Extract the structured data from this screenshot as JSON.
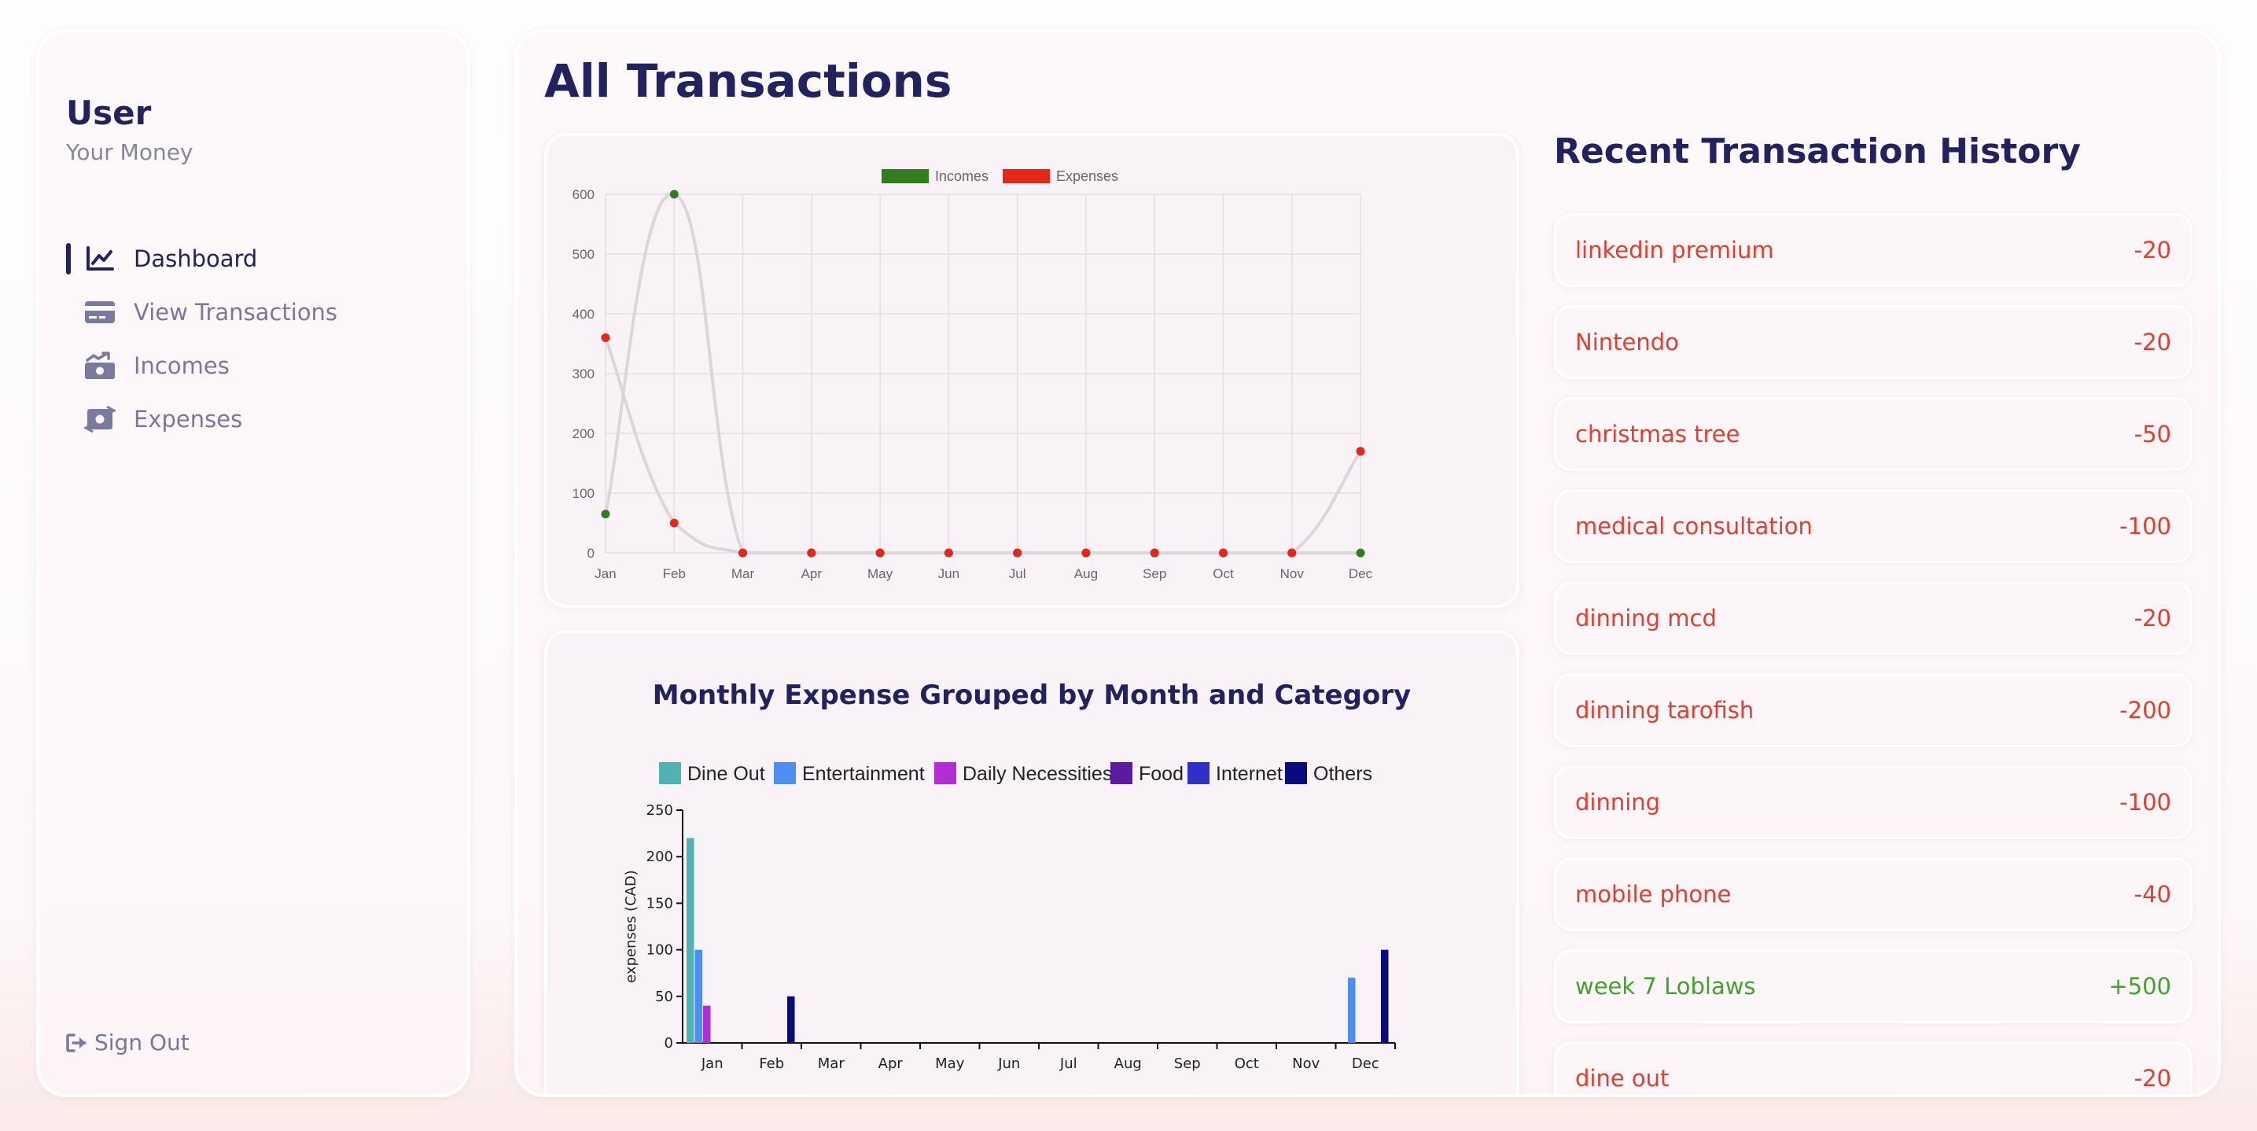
{
  "sidebar": {
    "user_name": "User",
    "user_subtitle": "Your Money",
    "nav": [
      {
        "label": "Dashboard",
        "icon": "chart-line-icon",
        "active": true
      },
      {
        "label": "View Transactions",
        "icon": "credit-card-icon",
        "active": false
      },
      {
        "label": "Incomes",
        "icon": "money-bill-trend-up-icon",
        "active": false
      },
      {
        "label": "Expenses",
        "icon": "money-bill-transfer-icon",
        "active": false
      }
    ],
    "signout_label": "Sign Out"
  },
  "main": {
    "title": "All Transactions",
    "history_title": "Recent Transaction History",
    "history": [
      {
        "name": "linkedin premium",
        "amount": "-20",
        "type": "expense"
      },
      {
        "name": "Nintendo",
        "amount": "-20",
        "type": "expense"
      },
      {
        "name": "christmas tree",
        "amount": "-50",
        "type": "expense"
      },
      {
        "name": "medical consultation",
        "amount": "-100",
        "type": "expense"
      },
      {
        "name": "dinning mcd",
        "amount": "-20",
        "type": "expense"
      },
      {
        "name": "dinning tarofish",
        "amount": "-200",
        "type": "expense"
      },
      {
        "name": "dinning",
        "amount": "-100",
        "type": "expense"
      },
      {
        "name": "mobile phone",
        "amount": "-40",
        "type": "expense"
      },
      {
        "name": "week 7 Loblaws",
        "amount": "+500",
        "type": "income"
      },
      {
        "name": "dine out",
        "amount": "-20",
        "type": "expense"
      }
    ]
  },
  "colors": {
    "income": "#42a22d",
    "expense": "#e03e30",
    "primary": "#222260"
  },
  "chart_data": [
    {
      "type": "line",
      "title": "",
      "x": [
        "Jan",
        "Feb",
        "Mar",
        "Apr",
        "May",
        "Jun",
        "Jul",
        "Aug",
        "Sep",
        "Oct",
        "Nov",
        "Dec"
      ],
      "series": [
        {
          "name": "Incomes",
          "color": "#2f7d1f",
          "values": [
            65,
            600,
            0,
            0,
            0,
            0,
            0,
            0,
            0,
            0,
            0,
            0
          ]
        },
        {
          "name": "Expenses",
          "color": "#e3271a",
          "values": [
            360,
            50,
            0,
            0,
            0,
            0,
            0,
            0,
            0,
            0,
            0,
            170
          ]
        }
      ],
      "ylim": [
        0,
        600
      ],
      "yticks": [
        0,
        100,
        200,
        300,
        400,
        500,
        600
      ],
      "legend": "top",
      "grid": true
    },
    {
      "type": "bar",
      "title": "Monthly Expense Grouped by Month and Category",
      "ylabel": "expenses (CAD)",
      "categories": [
        "Jan",
        "Feb",
        "Mar",
        "Apr",
        "May",
        "Jun",
        "Jul",
        "Aug",
        "Sep",
        "Oct",
        "Nov",
        "Dec"
      ],
      "series": [
        {
          "name": "Dine Out",
          "color": "#4fb3b3",
          "values": [
            220,
            0,
            0,
            0,
            0,
            0,
            0,
            0,
            0,
            0,
            0,
            0
          ]
        },
        {
          "name": "Entertainment",
          "color": "#4d8ff0",
          "values": [
            100,
            0,
            0,
            0,
            0,
            0,
            0,
            0,
            0,
            0,
            0,
            70
          ]
        },
        {
          "name": "Daily Necessities",
          "color": "#b32cd6",
          "values": [
            40,
            0,
            0,
            0,
            0,
            0,
            0,
            0,
            0,
            0,
            0,
            0
          ]
        },
        {
          "name": "Food",
          "color": "#5b1aa0",
          "values": [
            0,
            0,
            0,
            0,
            0,
            0,
            0,
            0,
            0,
            0,
            0,
            0
          ]
        },
        {
          "name": "Internet",
          "color": "#2f2fcc",
          "values": [
            0,
            0,
            0,
            0,
            0,
            0,
            0,
            0,
            0,
            0,
            0,
            0
          ]
        },
        {
          "name": "Others",
          "color": "#0a0a80",
          "values": [
            0,
            50,
            0,
            0,
            0,
            0,
            0,
            0,
            0,
            0,
            0,
            100
          ]
        }
      ],
      "ylim": [
        0,
        250
      ],
      "yticks": [
        0,
        50,
        100,
        150,
        200,
        250
      ],
      "legend": "top",
      "grid": false
    }
  ]
}
